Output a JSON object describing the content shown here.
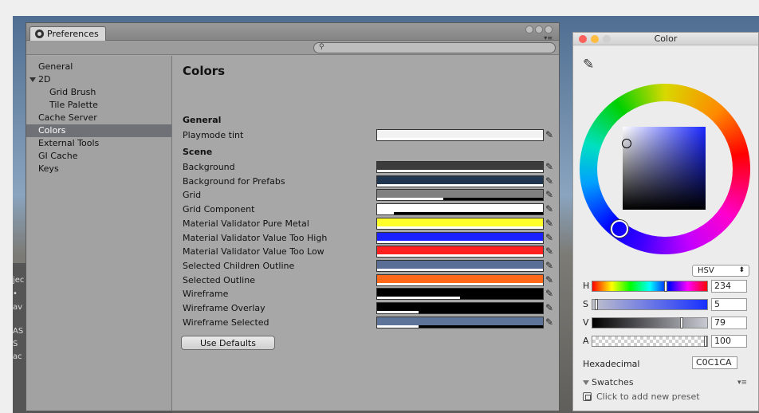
{
  "backdrop": {
    "side_texts": [
      "jec",
      "•",
      "av",
      "ASS",
      "S",
      "ac"
    ]
  },
  "prefs": {
    "tab_label": "Preferences",
    "search_placeholder": "",
    "sidebar": [
      {
        "label": "General",
        "kind": "item",
        "active": false
      },
      {
        "label": "2D",
        "kind": "group",
        "active": false
      },
      {
        "label": "Grid Brush",
        "kind": "child",
        "active": false
      },
      {
        "label": "Tile Palette",
        "kind": "child",
        "active": false
      },
      {
        "label": "Cache Server",
        "kind": "item",
        "active": false
      },
      {
        "label": "Colors",
        "kind": "item",
        "active": true
      },
      {
        "label": "External Tools",
        "kind": "item",
        "active": false
      },
      {
        "label": "GI Cache",
        "kind": "item",
        "active": false
      },
      {
        "label": "Keys",
        "kind": "item",
        "active": false
      }
    ],
    "title": "Colors",
    "general_heading": "General",
    "scene_heading": "Scene",
    "playmode": {
      "label": "Playmode tint",
      "color": "#f2f2f2",
      "alpha": 1.0
    },
    "scene_rows": [
      {
        "label": "Background",
        "color": "#3c3c3c",
        "alpha": 1.0
      },
      {
        "label": "Background for Prefabs",
        "color": "#1f3550",
        "alpha": 1.0
      },
      {
        "label": "Grid",
        "color": "#808080",
        "alpha": 0.4
      },
      {
        "label": "Grid Component",
        "color": "#ffffff",
        "alpha": 0.1
      },
      {
        "label": "Material Validator Pure Metal",
        "color": "#ffff2a",
        "alpha": 1.0
      },
      {
        "label": "Material Validator Value Too High",
        "color": "#1a22ff",
        "alpha": 1.0
      },
      {
        "label": "Material Validator Value Too Low",
        "color": "#ff2020",
        "alpha": 1.0
      },
      {
        "label": "Selected Children Outline",
        "color": "#5a6f95",
        "alpha": 1.0
      },
      {
        "label": "Selected Outline",
        "color": "#ff6a1a",
        "alpha": 1.0
      },
      {
        "label": "Wireframe",
        "color": "#000000",
        "alpha": 0.5
      },
      {
        "label": "Wireframe Overlay",
        "color": "#000000",
        "alpha": 0.25
      },
      {
        "label": "Wireframe Selected",
        "color": "#5e7499",
        "alpha": 0.25
      }
    ],
    "use_defaults_label": "Use Defaults"
  },
  "color_panel": {
    "title": "Color",
    "mode": "HSV",
    "sliders": [
      {
        "letter": "H",
        "value": "234",
        "level": 0.65
      },
      {
        "letter": "S",
        "value": "5",
        "level": 0.05
      },
      {
        "letter": "V",
        "value": "79",
        "level": 0.79
      },
      {
        "letter": "A",
        "value": "100",
        "level": 1.0
      }
    ],
    "hex_label": "Hexadecimal",
    "hex_value": "C0C1CA",
    "swatches_label": "Swatches",
    "add_preset_label": "Click to add new preset"
  }
}
